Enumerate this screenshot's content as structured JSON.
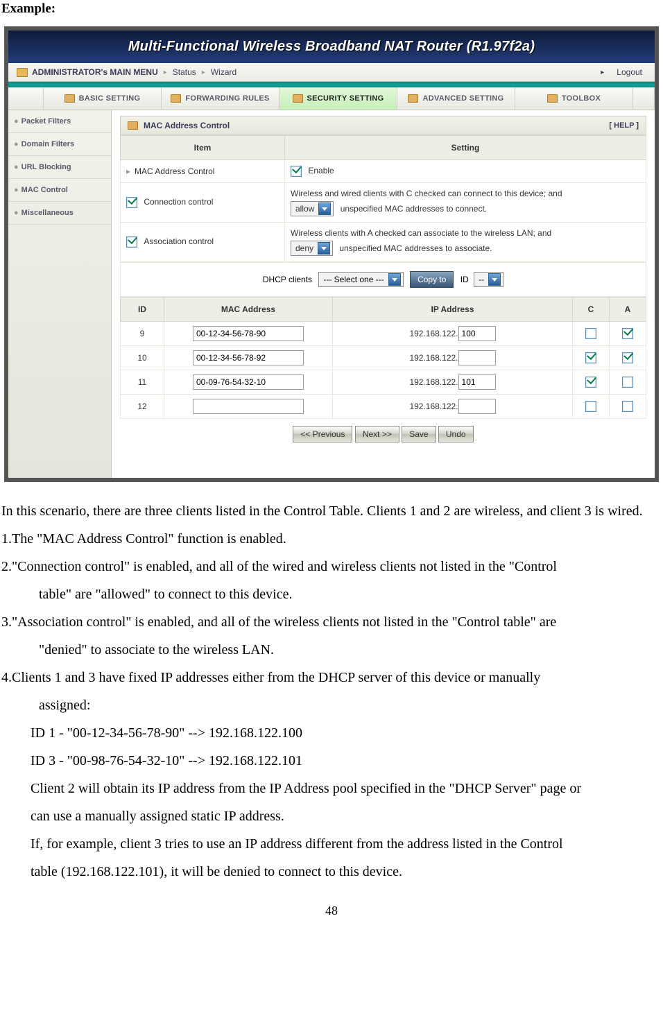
{
  "heading": "Example:",
  "titlebar": "Multi-Functional Wireless Broadband NAT Router (R1.97f2a)",
  "menubar": {
    "admin": "ADMINISTRATOR's MAIN MENU",
    "status": "Status",
    "wizard": "Wizard",
    "logout": "Logout"
  },
  "tabs": [
    "BASIC SETTING",
    "FORWARDING RULES",
    "SECURITY SETTING",
    "ADVANCED SETTING",
    "TOOLBOX"
  ],
  "sidebar": [
    "Packet Filters",
    "Domain Filters",
    "URL Blocking",
    "MAC Control",
    "Miscellaneous"
  ],
  "panel": {
    "title": "MAC Address Control",
    "help": "[ HELP ]"
  },
  "cfg": {
    "th_item": "Item",
    "th_setting": "Setting",
    "row1_item": "MAC Address Control",
    "row1_enable": "Enable",
    "row2_item": "Connection control",
    "row2_line1": "Wireless and wired clients with C checked can connect to this device; and",
    "row2_sel": "allow",
    "row2_line2": "unspecified MAC addresses to connect.",
    "row3_item": "Association control",
    "row3_line1": "Wireless clients with A checked can associate to the wireless LAN; and",
    "row3_sel": "deny",
    "row3_line2": "unspecified MAC addresses to associate."
  },
  "dhcp": {
    "label": "DHCP clients",
    "select": "--- Select one ---",
    "copy": "Copy to",
    "idlabel": "ID",
    "idsel": "--"
  },
  "ctl": {
    "headers": {
      "id": "ID",
      "mac": "MAC Address",
      "ip": "IP Address",
      "c": "C",
      "a": "A"
    },
    "ip_prefix": "192.168.122.",
    "rows": [
      {
        "id": "9",
        "mac": "00-12-34-56-78-90",
        "ip": "100",
        "c": false,
        "a": true
      },
      {
        "id": "10",
        "mac": "00-12-34-56-78-92",
        "ip": "",
        "c": true,
        "a": true
      },
      {
        "id": "11",
        "mac": "00-09-76-54-32-10",
        "ip": "101",
        "c": true,
        "a": false
      },
      {
        "id": "12",
        "mac": "",
        "ip": "",
        "c": false,
        "a": false
      }
    ]
  },
  "actions": {
    "prev": "<< Previous",
    "next": "Next >>",
    "save": "Save",
    "undo": "Undo"
  },
  "prose": {
    "p0": "In this scenario, there are three clients listed in the Control Table. Clients 1 and 2 are wireless, and client 3 is wired.",
    "p1": "1.The \"MAC Address Control\" function is enabled.",
    "p2": "2.\"Connection control\" is enabled, and all of the wired and wireless clients not listed in the \"Control table\" are \"allowed\" to connect to this device.",
    "p3": "3.\"Association control\" is enabled, and all of the wireless clients not listed in the \"Control table\" are \"denied\" to associate to the wireless LAN.",
    "p4": "4.Clients 1 and 3 have fixed IP addresses either from the DHCP server of this device or manually assigned:",
    "p5": "ID 1 - \"00-12-34-56-78-90\" --> 192.168.122.100",
    "p6": "ID 3 - \"00-98-76-54-32-10\" --> 192.168.122.101",
    "p7": "Client 2 will obtain its IP address from the IP Address pool specified in the \"DHCP Server\" page or can use a manually assigned static IP address.",
    "p8": "If, for example, client 3 tries to use an IP address different from the address listed in the Control table (192.168.122.101), it will be denied to connect to this device."
  },
  "pagenum": "48"
}
